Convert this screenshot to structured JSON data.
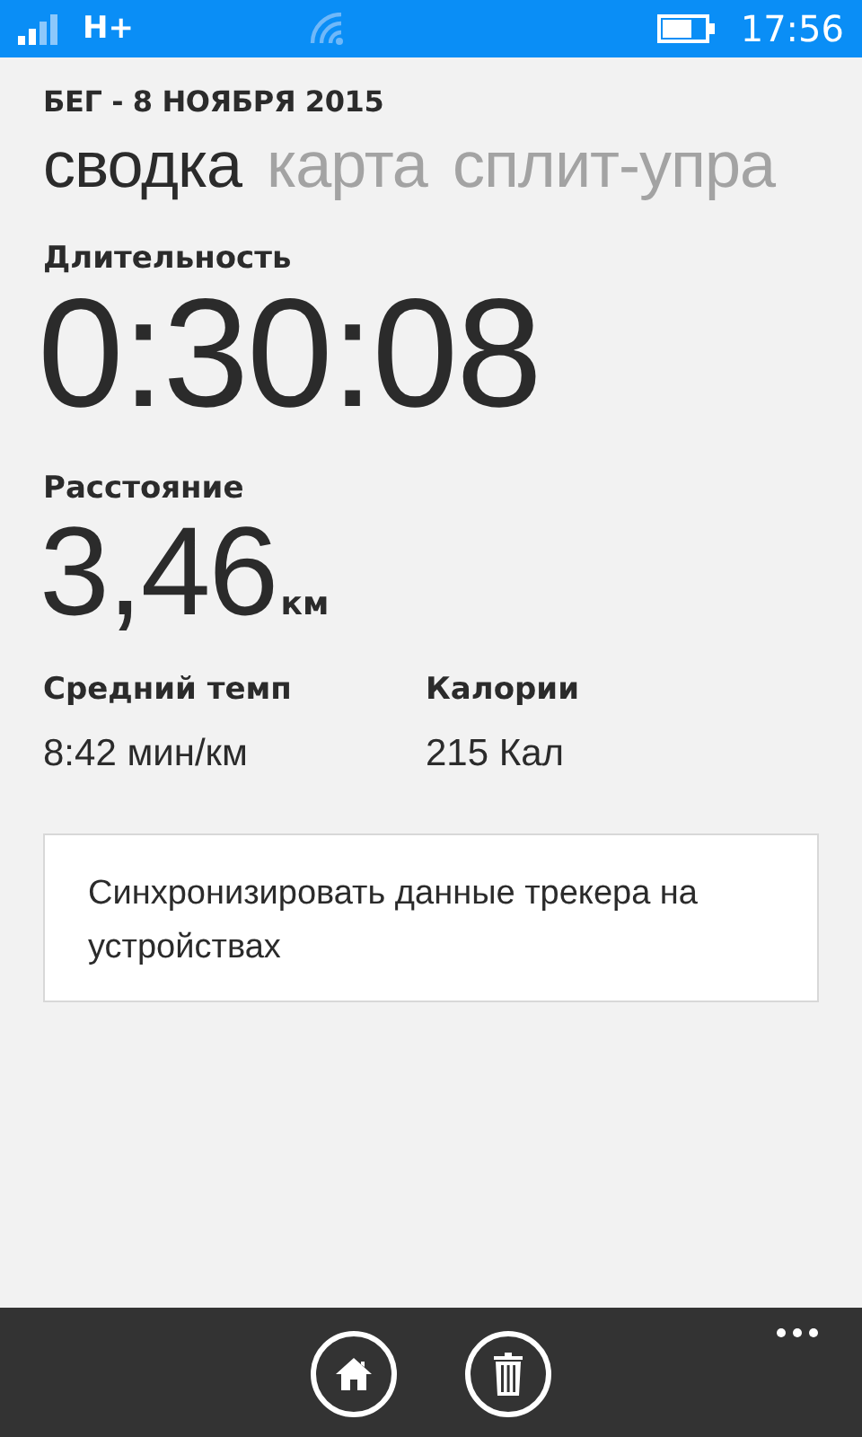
{
  "status_bar": {
    "network": "H+",
    "time": "17:56"
  },
  "header": {
    "title": "БЕГ - 8 НОЯБРЯ 2015"
  },
  "tabs": [
    {
      "label": "сводка",
      "selected": true
    },
    {
      "label": "карта",
      "selected": false
    },
    {
      "label": "сплит-упра",
      "selected": false
    }
  ],
  "duration": {
    "label": "Длительность",
    "value": "0:30:08"
  },
  "distance": {
    "label": "Расстояние",
    "value": "3,46",
    "unit": "км"
  },
  "stats": [
    {
      "label": "Средний темп",
      "value": "8:42 мин/км"
    },
    {
      "label": "Калории",
      "value": "215 Кал"
    }
  ],
  "sync_button": {
    "label": "Синхронизировать данные трекера на устройствах"
  },
  "app_bar": {
    "buttons": [
      {
        "kind": "home"
      },
      {
        "kind": "delete"
      }
    ]
  }
}
